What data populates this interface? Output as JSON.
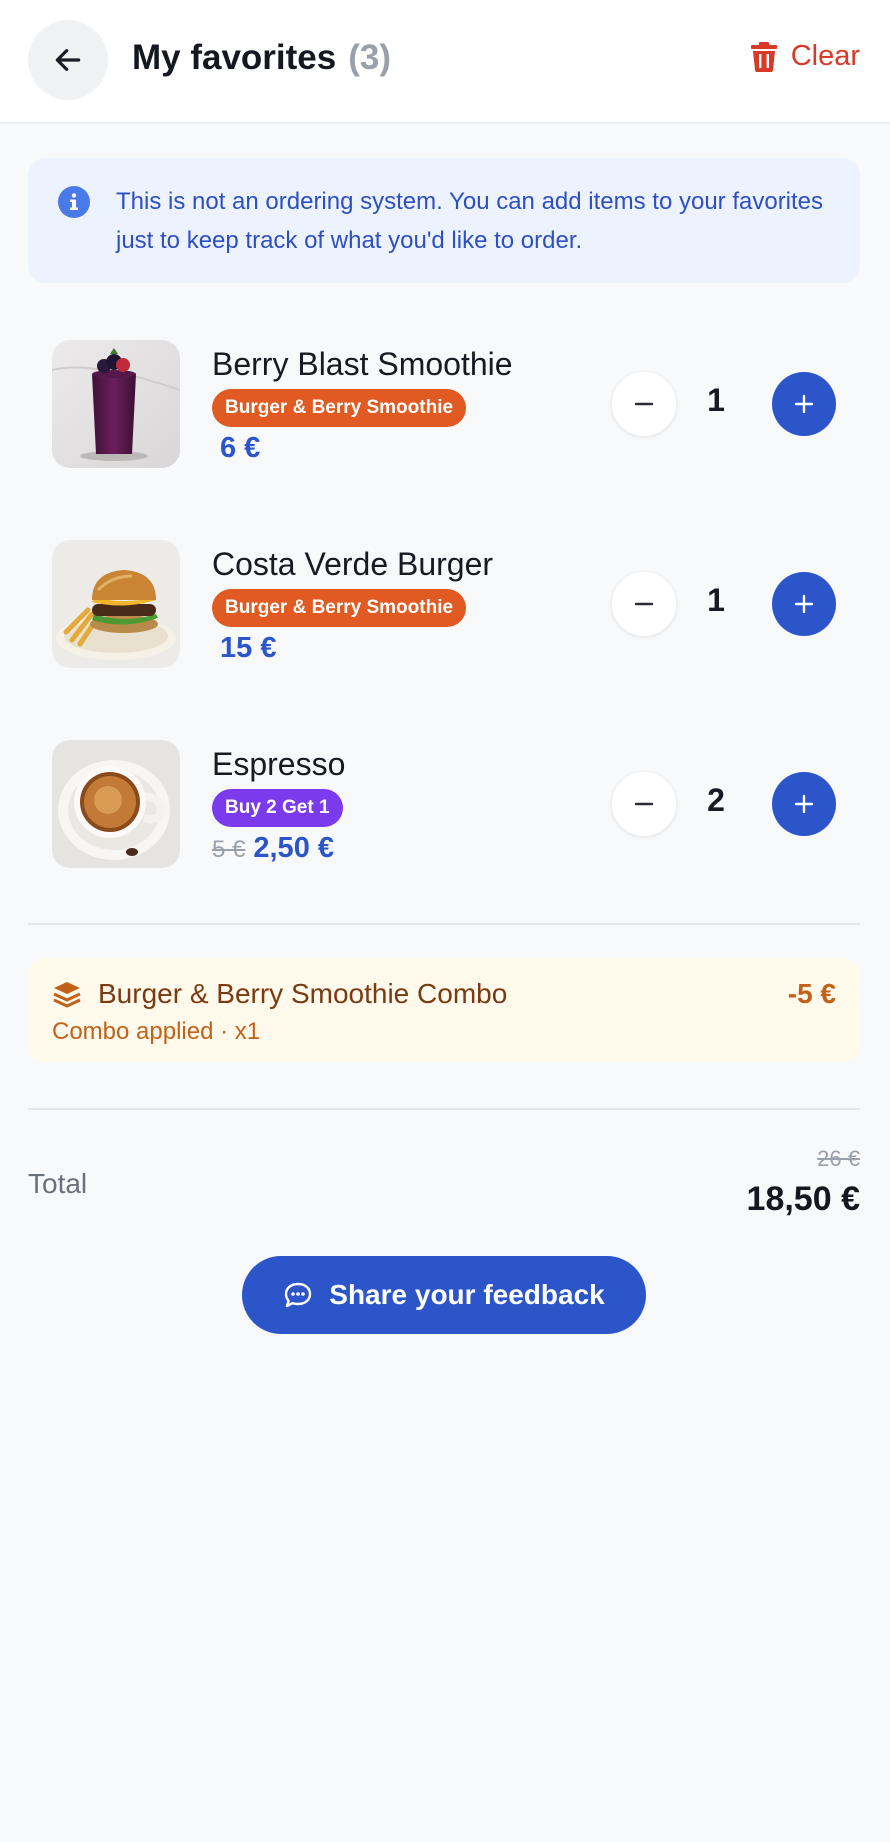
{
  "header": {
    "title": "My favorites",
    "count": "(3)",
    "clear_label": "Clear",
    "back_icon": "arrow-left-icon",
    "clear_icon": "trash-icon"
  },
  "info": {
    "icon": "info-icon",
    "text": "This is not an ordering system. You can add items to your favorites just to keep track of what you'd like to order."
  },
  "items": [
    {
      "name": "Berry Blast Smoothie",
      "tag": "Burger & Berry Smoothie",
      "old_price": "",
      "price": "6 €",
      "qty": "1"
    },
    {
      "name": "Costa Verde Burger",
      "tag": "Burger & Berry Smoothie",
      "old_price": "",
      "price": "15 €",
      "qty": "1"
    },
    {
      "name": "Espresso",
      "tag": "Buy 2 Get 1",
      "old_price": "5 €",
      "price": "2,50 €",
      "qty": "2"
    }
  ],
  "combo": {
    "icon": "layers-icon",
    "name": "Burger & Berry Smoothie Combo",
    "amount": "-5 €",
    "subtitle": "Combo applied · x1"
  },
  "total": {
    "label": "Total",
    "old": "26 €",
    "new": "18,50 €"
  },
  "feedback": {
    "label": "Share your feedback",
    "icon": "chat-bubble-icon"
  },
  "colors": {
    "accent": "#2b55c8",
    "danger": "#d83a2a",
    "combo_tag": "#e05a22",
    "promo_tag": "#7c3aed"
  }
}
